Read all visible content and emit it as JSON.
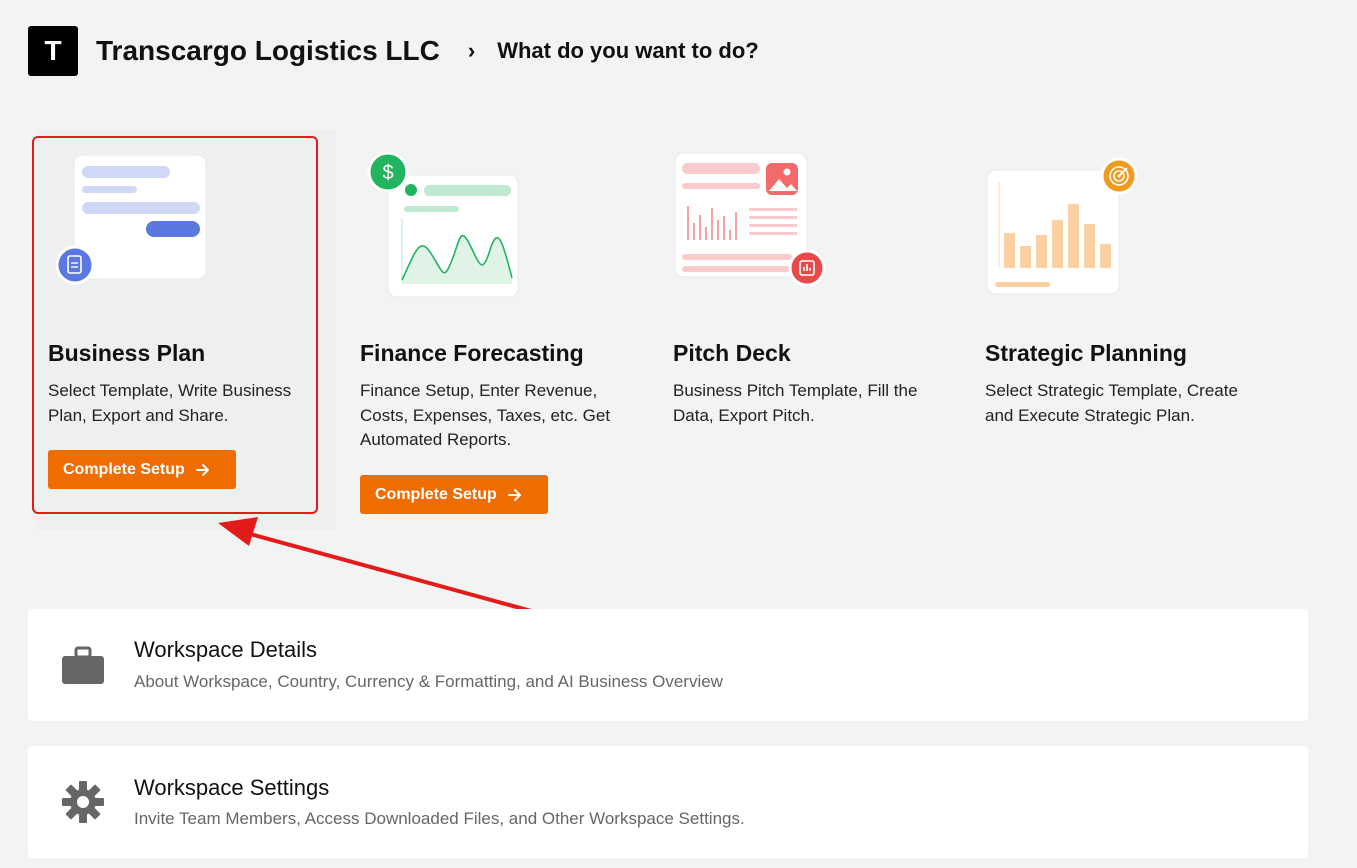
{
  "header": {
    "logo_letter": "T",
    "company": "Transcargo Logistics LLC",
    "separator": "›",
    "question": "What do you want to do?"
  },
  "cards": [
    {
      "title": "Business Plan",
      "description": "Select Template, Write Business Plan, Export and Share.",
      "button": "Complete Setup",
      "icon": "document-icon",
      "selected": true
    },
    {
      "title": "Finance Forecasting",
      "description": "Finance Setup, Enter Revenue, Costs, Expenses, Taxes, etc. Get Automated Reports.",
      "button": "Complete Setup",
      "icon": "dollar-icon"
    },
    {
      "title": "Pitch Deck",
      "description": "Business Pitch Template, Fill the Data, Export Pitch.",
      "icon": "chart-icon"
    },
    {
      "title": "Strategic Planning",
      "description": "Select Strategic Template, Create and Execute Strategic Plan.",
      "icon": "target-icon"
    }
  ],
  "workspace_details": {
    "title": "Workspace Details",
    "description": "About Workspace, Country, Currency & Formatting, and AI Business Overview",
    "icon": "briefcase-icon"
  },
  "workspace_settings": {
    "title": "Workspace Settings",
    "description": "Invite Team Members, Access Downloaded Files, and Other Workspace Settings.",
    "icon": "gear-icon"
  },
  "colors": {
    "accent": "#ef6c00",
    "highlight": "#e31b1b",
    "business_plan_blue": "#5b78e0",
    "finance_green": "#22b45f",
    "pitch_red": "#e84a4a",
    "strategy_orange": "#f29a1e"
  }
}
